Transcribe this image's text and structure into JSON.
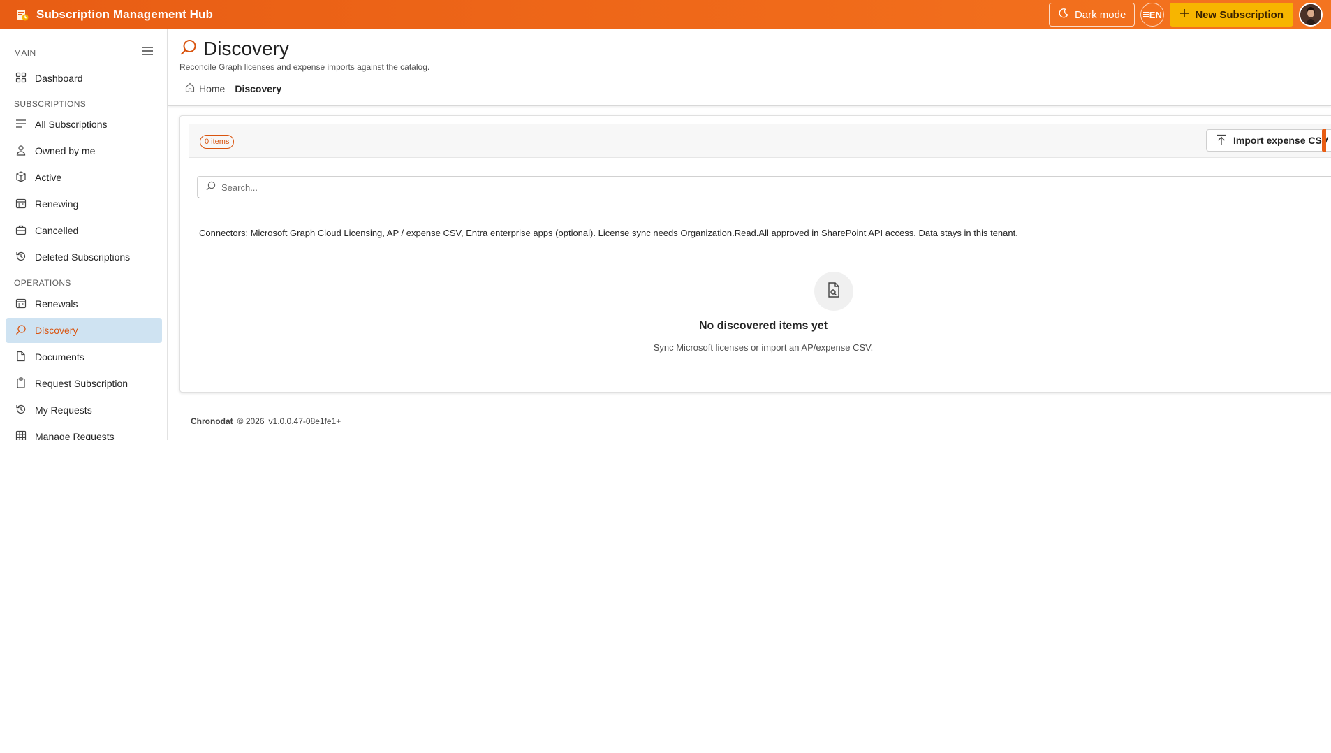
{
  "topbar": {
    "title": "Subscription Management Hub",
    "dark_mode_label": "Dark mode",
    "language": "EN",
    "new_subscription_label": "New Subscription",
    "brand_color": "#e85d14",
    "accent_color": "#f7b500"
  },
  "sidebar": {
    "sections": {
      "main": "MAIN",
      "subscriptions": "SUBSCRIPTIONS",
      "operations": "OPERATIONS"
    },
    "items": [
      {
        "label": "Dashboard",
        "icon": "grid-icon"
      },
      {
        "label": "All Subscriptions",
        "icon": "list-icon"
      },
      {
        "label": "Owned by me",
        "icon": "person-icon"
      },
      {
        "label": "Active",
        "icon": "box-icon"
      },
      {
        "label": "Renewing",
        "icon": "calendar-icon"
      },
      {
        "label": "Cancelled",
        "icon": "briefcase-icon"
      },
      {
        "label": "Deleted Subscriptions",
        "icon": "history-icon"
      },
      {
        "label": "Renewals",
        "icon": "calendar-icon"
      },
      {
        "label": "Discovery",
        "icon": "search-icon",
        "active": true
      },
      {
        "label": "Documents",
        "icon": "document-icon"
      },
      {
        "label": "Request Subscription",
        "icon": "clipboard-icon"
      },
      {
        "label": "My Requests",
        "icon": "history-icon"
      },
      {
        "label": "Manage Requests",
        "icon": "table-icon"
      }
    ],
    "active_color": "#cfe3f2"
  },
  "page": {
    "title": "Discovery",
    "subtitle": "Reconcile Graph licenses and expense imports against the catalog.",
    "breadcrumb": {
      "home": "Home",
      "current": "Discovery"
    }
  },
  "card": {
    "items_badge": "0 items",
    "import_label": "Import expense CSV",
    "search_placeholder": "Search...",
    "connectors_text": "Connectors: Microsoft Graph Cloud Licensing, AP / expense CSV, Entra enterprise apps (optional). License sync needs Organization.Read.All approved in SharePoint API access. Data stays in this tenant.",
    "empty_title": "No discovered items yet",
    "empty_subtitle": "Sync Microsoft licenses or import an AP/expense CSV."
  },
  "footer": {
    "org": "Chronodat",
    "copyright": "© 2026",
    "version": "v1.0.0.47-08e1fe1+"
  }
}
